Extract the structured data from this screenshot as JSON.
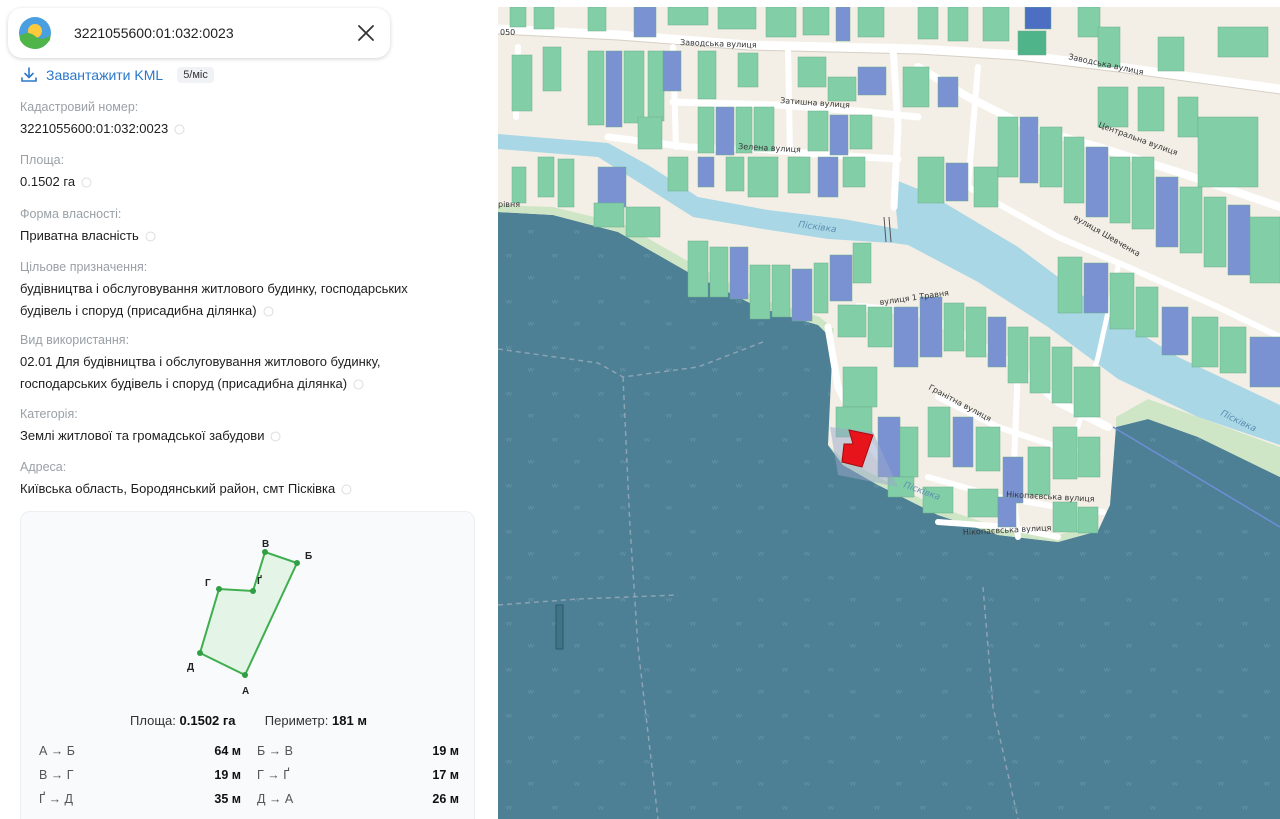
{
  "header": {
    "search_value": "3221055600:01:032:0023",
    "close_icon": "close-icon",
    "logo_icon": "sun-hills-logo"
  },
  "kml": {
    "label": "Завантажити KML",
    "badge": "5/міс",
    "icon": "download-icon"
  },
  "fields": [
    {
      "label": "Кадастровий номер:",
      "lines": [
        "3221055600:01:032:0023"
      ]
    },
    {
      "label": "Площа:",
      "lines": [
        "0.1502 га"
      ]
    },
    {
      "label": "Форма власності:",
      "lines": [
        "Приватна власність"
      ]
    },
    {
      "label": "Цільове призначення:",
      "lines": [
        "будівництва і обслуговування житлового будинку, господарських",
        "будівель і споруд (присадибна ділянка)"
      ]
    },
    {
      "label": "Вид використання:",
      "lines": [
        "02.01 Для будівництва і обслуговування житлового будинку,",
        "господарських будівель і споруд (присадибна ділянка)"
      ]
    },
    {
      "label": "Категорія:",
      "lines": [
        "Землі житлової та громадської забудови"
      ]
    },
    {
      "label": "Адреса:",
      "lines": [
        "Київська область, Бородянський район, смт Пісківка"
      ]
    }
  ],
  "plot": {
    "vertices": [
      "А",
      "Б",
      "В",
      "Г",
      "Ґ",
      "Д"
    ],
    "area_label": "Площа:",
    "area_value": "0.1502 га",
    "perimeter_label": "Периметр:",
    "perimeter_value": "181 м",
    "sides": [
      {
        "left_label": "А → Б",
        "left_value": "64 м",
        "right_label": "Б → В",
        "right_value": "19 м"
      },
      {
        "left_label": "В → Г",
        "left_value": "19 м",
        "right_label": "Г → Ґ",
        "right_value": "17 м"
      },
      {
        "left_label": "Ґ → Д",
        "left_value": "35 м",
        "right_label": "Д → А",
        "right_value": "26 м"
      }
    ]
  },
  "map": {
    "edge_label": "050",
    "streets": [
      "Заводська вулиця",
      "Заводська вулиця",
      "Затишна вулиця",
      "Зелена вулиця",
      "Центральна вулиця",
      "вулиця Шевченка",
      "вулиця 1 Травня",
      "Гранітна вулиця",
      "Нікопаєвська вулиця",
      "Нікопаєвська вулиця"
    ],
    "water": [
      "Пісківка",
      "Пісківка",
      "Пісківка"
    ],
    "colors": {
      "land": "#f4efe6",
      "building_green": "#82cfa7",
      "building_blue": "#7a92d2",
      "river": "#a9d7e6",
      "reservoir": "#4d7f95",
      "selected_parcel": "#e8141b",
      "selected_outline": "#9aa8c9"
    }
  }
}
